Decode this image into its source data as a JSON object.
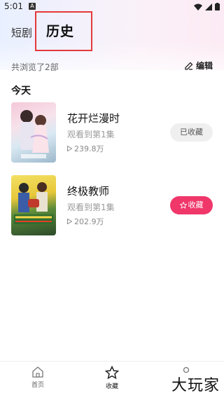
{
  "status_bar": {
    "time": "5:01",
    "badge": "A"
  },
  "tabs": {
    "drama": "短剧",
    "history": "历史"
  },
  "summary": {
    "text": "共浏览了2部",
    "edit_label": "编辑"
  },
  "section": {
    "title": "今天"
  },
  "items": [
    {
      "title": "花开烂漫时",
      "progress": "观看到第1集",
      "views": "239.8万",
      "button": "已收藏"
    },
    {
      "title": "终极教师",
      "progress": "观看到第1集",
      "views": "202.9万",
      "button": "收藏"
    }
  ],
  "bottom_nav": [
    {
      "label": "首页",
      "icon": "home-icon"
    },
    {
      "label": "收藏",
      "icon": "star-icon"
    },
    {
      "label": "",
      "icon": "person-icon"
    }
  ],
  "watermark": "大玩家",
  "colors": {
    "accent": "#f0376a",
    "highlight_box": "#e4393c"
  }
}
